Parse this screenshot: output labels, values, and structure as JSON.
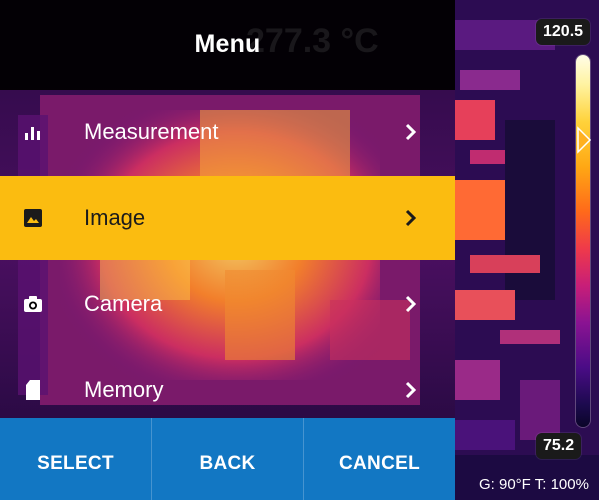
{
  "menu": {
    "title": "Menu",
    "background_readout": "277.3 °C",
    "items": [
      {
        "label": "Measurement",
        "icon": "bar-chart-icon",
        "selected": false
      },
      {
        "label": "Image",
        "icon": "image-icon",
        "selected": true
      },
      {
        "label": "Camera",
        "icon": "camera-icon",
        "selected": false
      },
      {
        "label": "Memory",
        "icon": "sd-card-icon",
        "selected": false
      }
    ]
  },
  "softkeys": {
    "select": "SELECT",
    "back": "BACK",
    "cancel": "CANCEL"
  },
  "scale": {
    "max": "120.5",
    "min": "75.2"
  },
  "status": {
    "text": "G: 90°F  T: 100%"
  },
  "colors": {
    "highlight": "#fbbc10",
    "softkey_bar": "#1277c3",
    "header": "#000000"
  }
}
